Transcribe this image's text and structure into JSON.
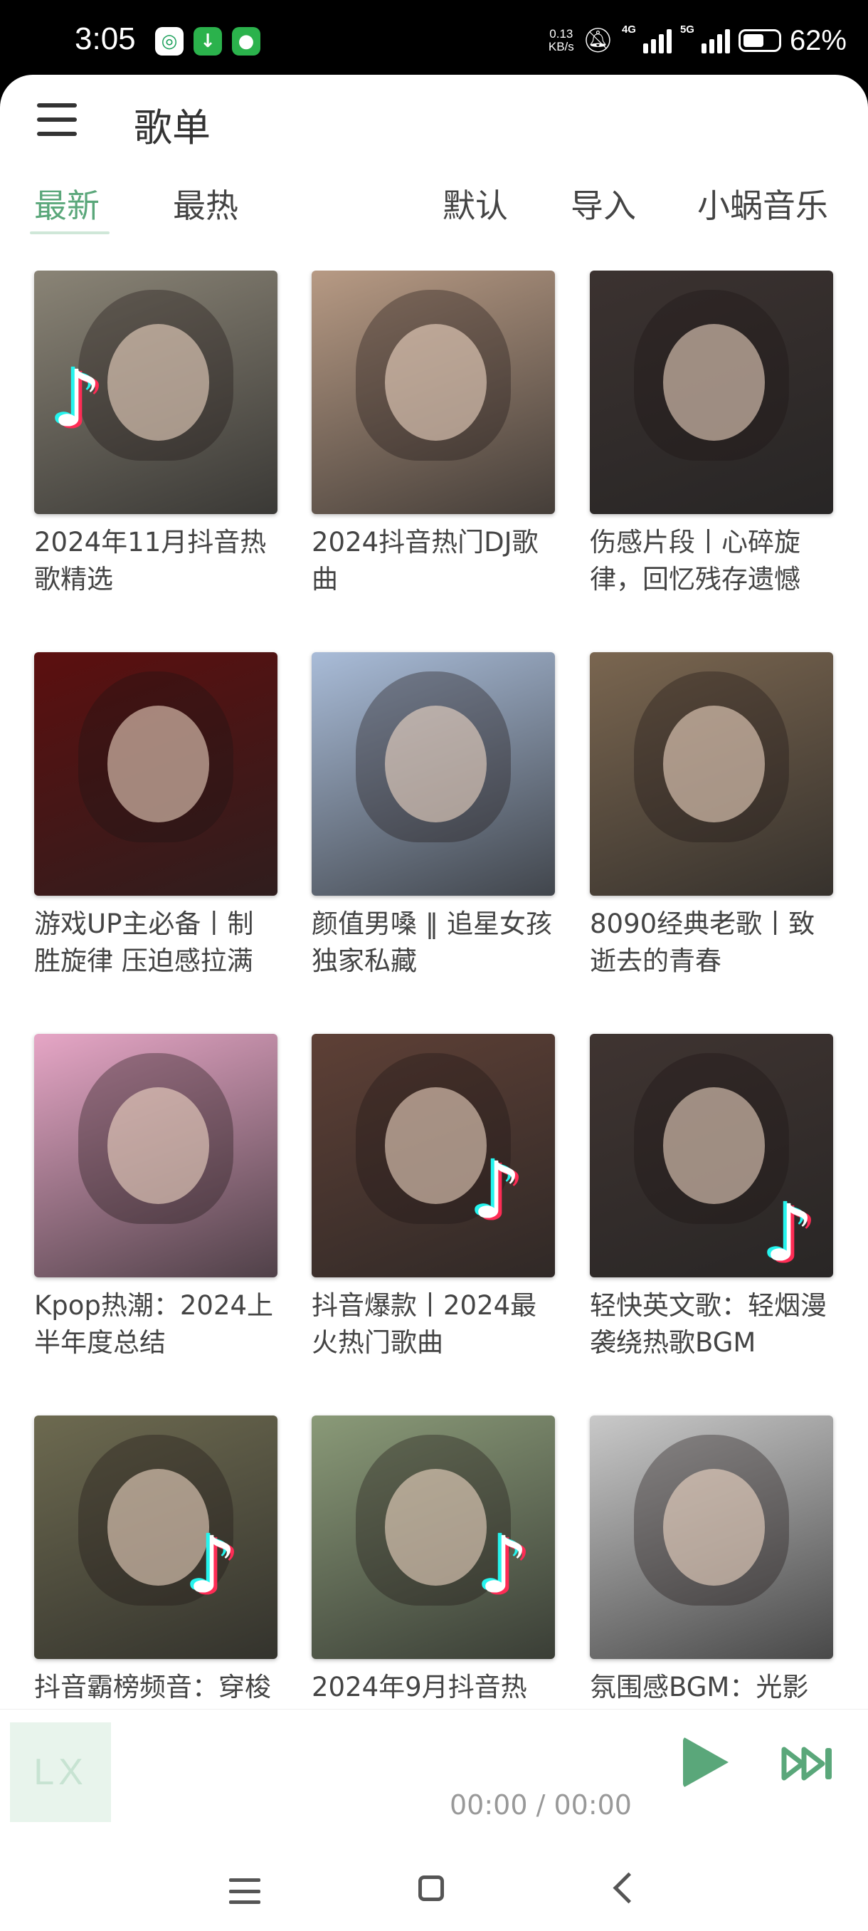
{
  "status_bar": {
    "time": "3:05",
    "net_speed_value": "0.13",
    "net_speed_unit": "KB/s",
    "signal1_label": "4G",
    "signal2_label": "5G",
    "battery_percent": "62%",
    "app_icons": [
      "app-icon",
      "download-icon",
      "wechat-icon"
    ]
  },
  "header": {
    "menu_icon": "hamburger-menu-icon",
    "title": "歌单"
  },
  "tabs": [
    {
      "label": "最新",
      "active": true
    },
    {
      "label": "最热",
      "active": false
    },
    {
      "label": "默认",
      "active": false
    },
    {
      "label": "导入",
      "active": false
    },
    {
      "label": "小蜗音乐",
      "active": false
    }
  ],
  "playlists": [
    {
      "title": "2024年11月抖音热歌精选",
      "cover_color": "#8a8476",
      "tiktok_logo": true
    },
    {
      "title": "2024抖音热门DJ歌曲",
      "cover_color": "#b79a84",
      "tiktok_logo": false
    },
    {
      "title": "伤感片段丨心碎旋律，回忆残存遗憾",
      "cover_color": "#3b3230",
      "tiktok_logo": false
    },
    {
      "title": "游戏UP主必备丨制胜旋律 压迫感拉满",
      "cover_color": "#5c0f0f",
      "tiktok_logo": false
    },
    {
      "title": "颜值男嗓 ‖ 追星女孩独家私藏",
      "cover_color": "#a9bcd8",
      "tiktok_logo": false
    },
    {
      "title": "8090经典老歌丨致逝去的青春",
      "cover_color": "#7a6650",
      "tiktok_logo": false
    },
    {
      "title": "Kpop热潮：2024上半年度总结",
      "cover_color": "#e6a6c6",
      "tiktok_logo": false
    },
    {
      "title": "抖音爆款丨2024最火热门歌曲",
      "cover_color": "#5e4036",
      "tiktok_logo": true
    },
    {
      "title": "轻快英文歌：轻烟漫袭绕热歌BGM",
      "cover_color": "#3f3431",
      "tiktok_logo": true
    },
    {
      "title": "抖音霸榜频音：穿梭",
      "cover_color": "#6d6a50",
      "tiktok_logo": true
    },
    {
      "title": "2024年9月抖音热",
      "cover_color": "#8a9a78",
      "tiktok_logo": true
    },
    {
      "title": "氛围感BGM：光影",
      "cover_color": "#c9c9c9",
      "tiktok_logo": false
    }
  ],
  "player": {
    "logo_text": "LX",
    "time": "00:00 / 00:00",
    "accent_color": "#5aa77a",
    "play_icon": "play-icon",
    "next_icon": "skip-next-icon"
  },
  "nav_bar": {
    "icons": [
      "recents-icon",
      "home-icon",
      "back-icon"
    ]
  }
}
